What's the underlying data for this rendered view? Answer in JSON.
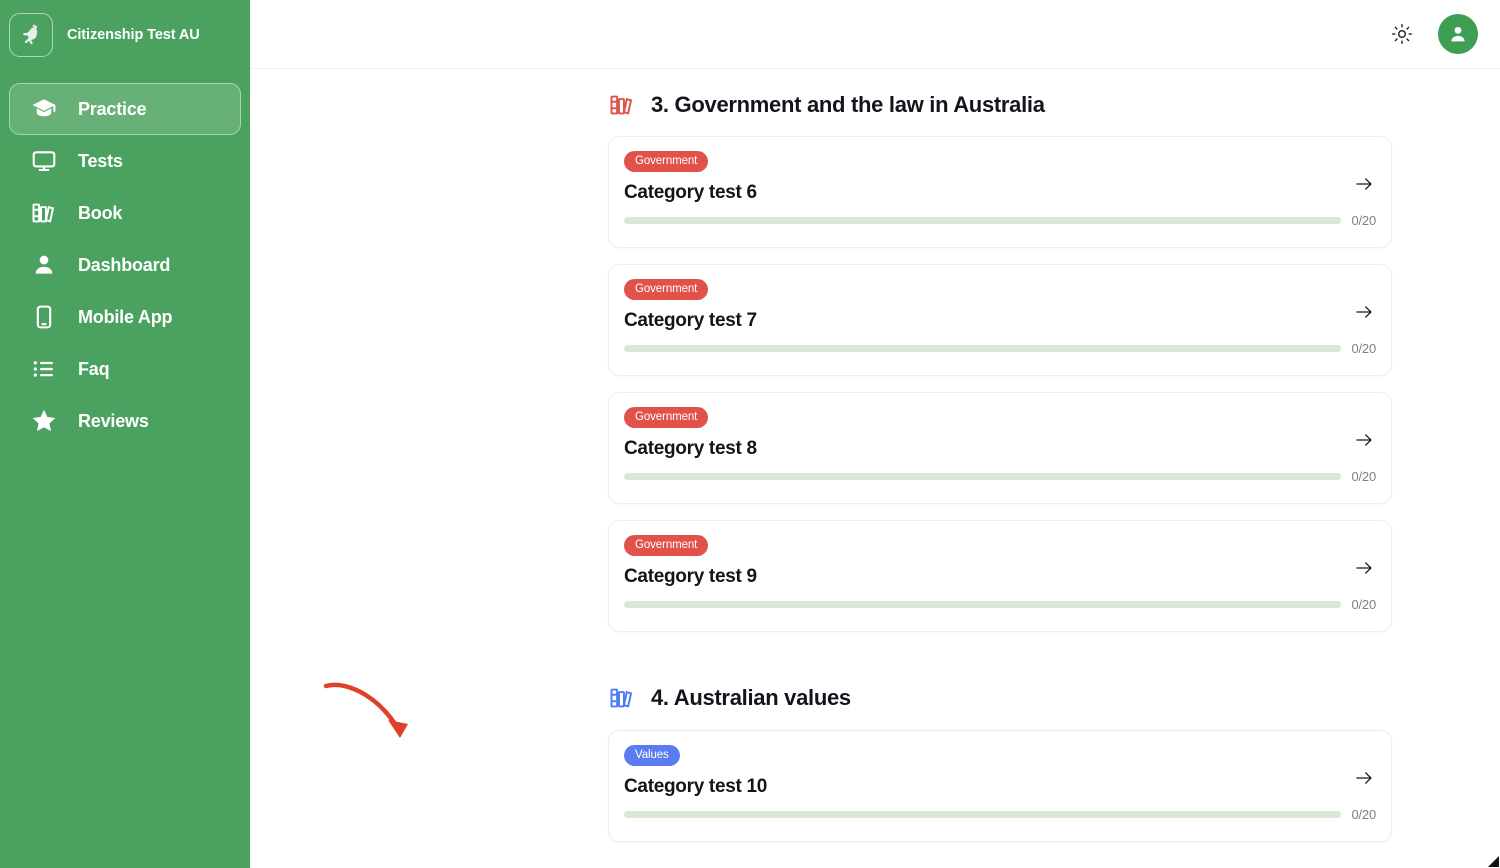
{
  "sidebar": {
    "brand": {
      "name": "Citizenship Test AU",
      "logo_icon": "kangaroo-icon"
    },
    "items": [
      {
        "label": "Practice",
        "icon": "graduation-cap-icon",
        "active": true
      },
      {
        "label": "Tests",
        "icon": "monitor-icon",
        "active": false
      },
      {
        "label": "Book",
        "icon": "books-icon",
        "active": false
      },
      {
        "label": "Dashboard",
        "icon": "user-icon",
        "active": false
      },
      {
        "label": "Mobile App",
        "icon": "mobile-phone-icon",
        "active": false
      },
      {
        "label": "Faq",
        "icon": "list-icon",
        "active": false
      },
      {
        "label": "Reviews",
        "icon": "star-icon",
        "active": false
      }
    ],
    "background_color": "#4ba260"
  },
  "topbar": {
    "theme_toggle_icon": "sun-icon",
    "avatar_icon": "user-avatar-icon",
    "avatar_color": "#3d9e54"
  },
  "sections": [
    {
      "title": "3. Government and the law in Australia",
      "icon": "books-icon",
      "icon_color": "#e0524a",
      "cards": [
        {
          "badge": "Government",
          "badge_type": "government",
          "title": "Category test 6",
          "progress_label": "0/20",
          "progress_percent": 0,
          "arrow_icon": "arrow-right-icon"
        },
        {
          "badge": "Government",
          "badge_type": "government",
          "title": "Category test 7",
          "progress_label": "0/20",
          "progress_percent": 0,
          "arrow_icon": "arrow-right-icon"
        },
        {
          "badge": "Government",
          "badge_type": "government",
          "title": "Category test 8",
          "progress_label": "0/20",
          "progress_percent": 0,
          "arrow_icon": "arrow-right-icon"
        },
        {
          "badge": "Government",
          "badge_type": "government",
          "title": "Category test 9",
          "progress_label": "0/20",
          "progress_percent": 0,
          "arrow_icon": "arrow-right-icon"
        }
      ]
    },
    {
      "title": "4. Australian values",
      "icon": "books-icon",
      "icon_color": "#4a7df5",
      "cards": [
        {
          "badge": "Values",
          "badge_type": "values",
          "title": "Category test 10",
          "progress_label": "0/20",
          "progress_percent": 0,
          "arrow_icon": "arrow-right-icon"
        }
      ]
    }
  ],
  "annotation": {
    "type": "curved-arrow",
    "color": "#e0402a",
    "points_to": "4. Australian values"
  },
  "colors": {
    "sidebar_green": "#4ba260",
    "badge_red": "#e0524a",
    "badge_blue": "#5b7cf0",
    "progress_track": "#d8e8d3",
    "annotation_red": "#e0402a"
  }
}
